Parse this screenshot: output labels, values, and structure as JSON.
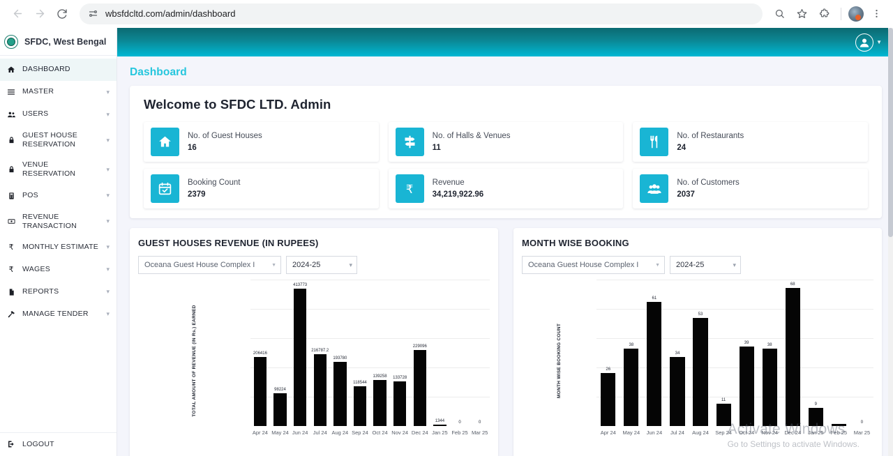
{
  "browser": {
    "url": "wbsfdcltd.com/admin/dashboard",
    "back_icon": "back-arrow-icon",
    "forward_icon": "forward-arrow-icon",
    "reload_icon": "reload-icon",
    "site_settings_icon": "site-settings-icon",
    "zoom_icon": "zoom-icon",
    "bookmark_icon": "star-icon",
    "extensions_icon": "extensions-icon",
    "menu_icon": "kebab-menu-icon"
  },
  "sidebar": {
    "brand": "SFDC, West Bengal",
    "items": [
      {
        "label": "DASHBOARD",
        "icon": "home-icon",
        "expandable": false,
        "active": true
      },
      {
        "label": "MASTER",
        "icon": "list-icon",
        "expandable": true,
        "active": false
      },
      {
        "label": "USERS",
        "icon": "users-icon",
        "expandable": true,
        "active": false
      },
      {
        "label": "GUEST HOUSE RESERVATION",
        "icon": "lock-icon",
        "expandable": true,
        "active": false
      },
      {
        "label": "VENUE RESERVATION",
        "icon": "lock-icon",
        "expandable": true,
        "active": false
      },
      {
        "label": "POS",
        "icon": "register-icon",
        "expandable": true,
        "active": false
      },
      {
        "label": "REVENUE TRANSACTION",
        "icon": "money-icon",
        "expandable": true,
        "active": false
      },
      {
        "label": "MONTHLY ESTIMATE",
        "icon": "rupee-icon",
        "expandable": true,
        "active": false
      },
      {
        "label": "WAGES",
        "icon": "rupee-icon",
        "expandable": true,
        "active": false
      },
      {
        "label": "REPORTS",
        "icon": "file-icon",
        "expandable": true,
        "active": false
      },
      {
        "label": "MANAGE TENDER",
        "icon": "hammer-icon",
        "expandable": true,
        "active": false
      }
    ],
    "logout": {
      "label": "LOGOUT",
      "icon": "logout-icon"
    }
  },
  "topbar": {
    "user_icon": "user-circle-icon",
    "caret_icon": "chevron-down-icon",
    "gradient_from": "#0b6a72",
    "gradient_to": "#00b8d4"
  },
  "page": {
    "title": "Dashboard",
    "title_color": "#25c6dd",
    "welcome": "Welcome to SFDC LTD. Admin"
  },
  "stats": [
    {
      "label": "No. of Guest Houses",
      "value": "16",
      "icon": "home-icon"
    },
    {
      "label": "No. of Halls & Venues",
      "value": "11",
      "icon": "signpost-icon"
    },
    {
      "label": "No. of Restaurants",
      "value": "24",
      "icon": "cutlery-icon"
    },
    {
      "label": "Booking Count",
      "value": "2379",
      "icon": "calendar-check-icon"
    },
    {
      "label": "Revenue",
      "value": "34,219,922.96",
      "icon": "rupee-icon"
    },
    {
      "label": "No. of Customers",
      "value": "2037",
      "icon": "users-group-icon"
    }
  ],
  "stat_accent": "#19b5d4",
  "charts": {
    "left": {
      "title": "GUEST HOUSES REVENUE (IN RUPEES)",
      "filter_property": "Oceana Guest House Complex I",
      "filter_year": "2024-25"
    },
    "right": {
      "title": "MONTH WISE BOOKING",
      "filter_property": "Oceana Guest House Complex I",
      "filter_year": "2024-25"
    }
  },
  "chart_data": [
    {
      "type": "bar",
      "id": "guest-houses-revenue",
      "title": "GUEST HOUSES REVENUE (IN RUPEES)",
      "xlabel": "",
      "ylabel": "TOTAL AMOUNT OF REVENUE (IN Rs.) EARNED",
      "categories": [
        "Apr 24",
        "May 24",
        "Jun 24",
        "Jul 24",
        "Aug 24",
        "Sep 24",
        "Oct 24",
        "Nov 24",
        "Dec 24",
        "Jan 25",
        "Feb 25",
        "Mar 25"
      ],
      "values": [
        206416,
        98224,
        413773,
        216787.2,
        193780,
        118544,
        139258,
        133728,
        229096,
        1344,
        0,
        0
      ],
      "labels": [
        "206416",
        "98224",
        "413773",
        "216787.2",
        "193780",
        "118544",
        "139258",
        "133728",
        "229096",
        "1344",
        "0",
        "0"
      ],
      "ylim": [
        0,
        440000
      ],
      "grid": true,
      "bar_color": "#050505",
      "legend": "none"
    },
    {
      "type": "bar",
      "id": "month-wise-booking",
      "title": "MONTH WISE BOOKING",
      "xlabel": "",
      "ylabel": "MONTH WISE BOOKING COUNT",
      "categories": [
        "Apr 24",
        "May 24",
        "Jun 24",
        "Jul 24",
        "Aug 24",
        "Sep 24",
        "Oct 24",
        "Nov 24",
        "Dec 24",
        "Jan 25",
        "Feb 25",
        "Mar 25"
      ],
      "values": [
        26,
        38,
        61,
        34,
        53,
        11,
        39,
        38,
        68,
        9,
        1,
        0
      ],
      "labels": [
        "26",
        "38",
        "61",
        "34",
        "53",
        "11",
        "39",
        "38",
        "68",
        "9",
        "",
        "0"
      ],
      "ylim": [
        0,
        72
      ],
      "grid": true,
      "bar_color": "#050505",
      "legend": "none"
    }
  ],
  "watermark": {
    "line1": "Activate Windows",
    "line2": "Go to Settings to activate Windows."
  }
}
